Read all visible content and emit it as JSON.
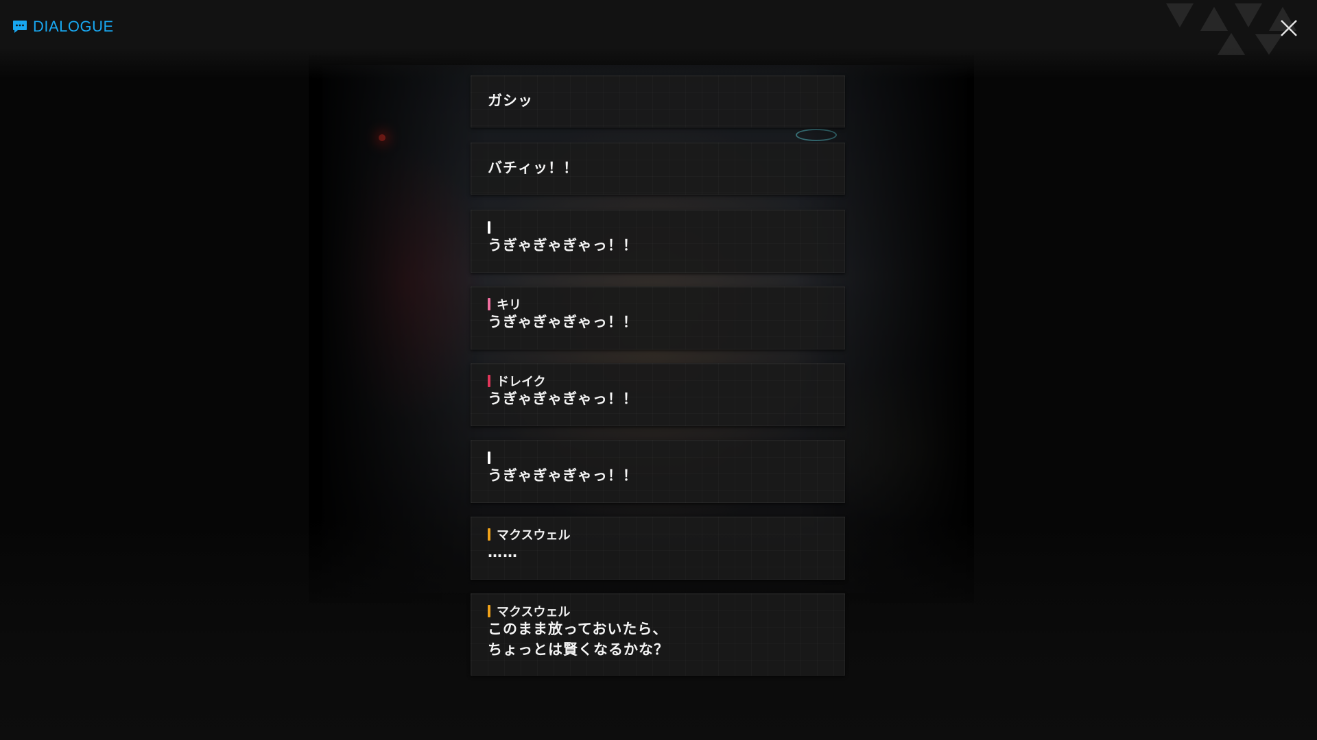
{
  "header": {
    "title": "DIALOGUE",
    "icon": "chat-bubble-icon",
    "accent_color": "#18a7f0"
  },
  "close": {
    "icon": "close-icon"
  },
  "dialogue": [
    {
      "speaker": "",
      "bar_color": "",
      "lines": [
        "ガシッ"
      ]
    },
    {
      "speaker": "",
      "bar_color": "",
      "lines": [
        "バチィッ！！"
      ]
    },
    {
      "speaker": "",
      "bar_color": "#ffffff",
      "lines": [
        "うぎゃぎゃぎゃっ！！"
      ]
    },
    {
      "speaker": "キリ",
      "bar_color": "#f06fa0",
      "lines": [
        "うぎゃぎゃぎゃっ！！"
      ]
    },
    {
      "speaker": "ドレイク",
      "bar_color": "#e0365a",
      "lines": [
        "うぎゃぎゃぎゃっ！！"
      ]
    },
    {
      "speaker": "",
      "bar_color": "#ffffff",
      "lines": [
        "うぎゃぎゃぎゃっ！！"
      ]
    },
    {
      "speaker": "マクスウェル",
      "bar_color": "#f0a21a",
      "lines": [
        "……"
      ]
    },
    {
      "speaker": "マクスウェル",
      "bar_color": "#f0a21a",
      "lines": [
        "このまま放っておいたら、",
        "ちょっとは賢くなるかな？"
      ]
    }
  ]
}
